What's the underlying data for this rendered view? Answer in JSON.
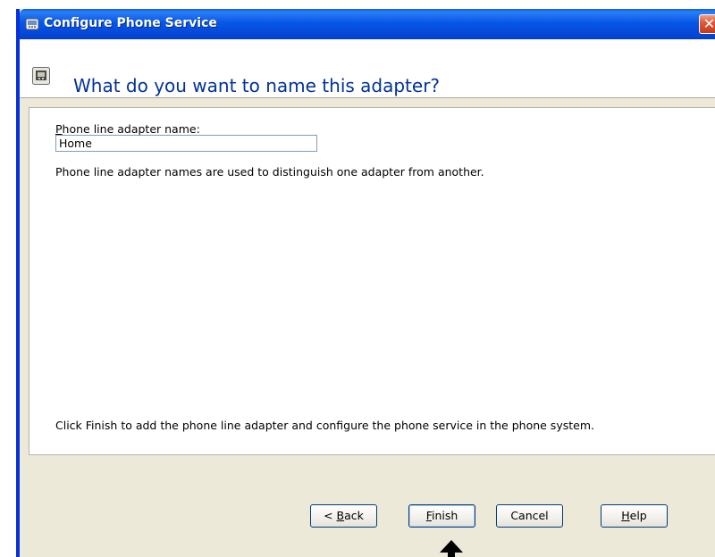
{
  "window": {
    "title": "Configure Phone Service",
    "close_glyph": "✕",
    "title_icon": "phone-service-icon"
  },
  "header": {
    "title": "What do you want to name this adapter?",
    "icon": "phone-adapter-icon"
  },
  "form": {
    "label_accel": "P",
    "label_rest": "hone line adapter name:",
    "name_value": "Home",
    "help_text": "Phone line adapter names are used to distinguish one adapter from another."
  },
  "instructions": "Click Finish to add the phone line adapter and configure the phone service in the phone system.",
  "buttons": {
    "back_prefix": "< ",
    "back_accel": "B",
    "back_rest": "ack",
    "finish_accel": "F",
    "finish_rest": "inish",
    "cancel": "Cancel",
    "help_accel": "H",
    "help_rest": "elp"
  },
  "colors": {
    "title_bar": "#0857e5",
    "heading": "#003399",
    "dialog_bg": "#ece9d8",
    "close_button": "#e05a3a"
  },
  "annotation": {
    "pointer_icon": "up-arrow-icon",
    "target": "Finish"
  }
}
